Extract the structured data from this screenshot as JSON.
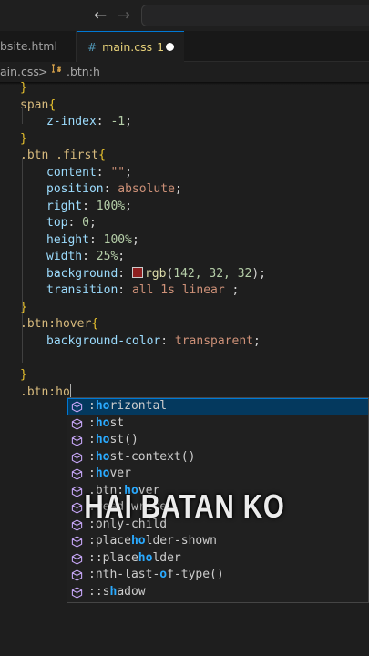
{
  "titlebar": {
    "back_icon": "←",
    "forward_icon": "→"
  },
  "tabs": [
    {
      "label": "bsite.html"
    },
    {
      "label": "main.css",
      "icon": "#",
      "problems": "1",
      "modified": true
    }
  ],
  "breadcrumbs": {
    "file": "ain.css",
    "separator": ">",
    "symbol": ".btn:h"
  },
  "code": {
    "l1": "}",
    "l2_sel": "span",
    "l2_brace": "{",
    "l3_prop": "z-index",
    "l3_colon": ": ",
    "l3_val": "-1",
    "l3_end": ";",
    "l4": "}",
    "l5_sel": ".btn .first",
    "l5_brace": "{",
    "l6_prop": "content",
    "l6_colon": ": ",
    "l6_val": "\"\"",
    "l6_end": ";",
    "l7_prop": "position",
    "l7_colon": ": ",
    "l7_val": "absolute",
    "l7_end": ";",
    "l8_prop": "right",
    "l8_colon": ": ",
    "l8_val": "100%",
    "l8_end": ";",
    "l9_prop": "top",
    "l9_colon": ": ",
    "l9_val": "0",
    "l9_end": ";",
    "l10_prop": "height",
    "l10_colon": ": ",
    "l10_val": "100%",
    "l10_end": ";",
    "l11_prop": "width",
    "l11_colon": ": ",
    "l11_val": "25%",
    "l11_end": ";",
    "l12_prop": "background",
    "l12_colon": ": ",
    "l12_fn": "rgb",
    "l12_open": "(",
    "l12_args": "142, 32, 32",
    "l12_close": ")",
    "l12_end": ";",
    "l13_prop": "transition",
    "l13_colon": ": ",
    "l13_val": "all 1s linear",
    "l13_end": " ;",
    "l14": "}",
    "l15_sel": ".btn:hover",
    "l15_brace": "{",
    "l16_prop": "background-color",
    "l16_colon": ": ",
    "l16_val": "transparent",
    "l16_end": ";",
    "l18": "}",
    "l19_sel": ".btn:ho"
  },
  "swatch_color": "#8e2020",
  "suggestions": [
    {
      "pre": ":",
      "hl": "ho",
      "post": "rizontal",
      "selected": true
    },
    {
      "pre": ":",
      "hl": "ho",
      "post": "st"
    },
    {
      "pre": ":",
      "hl": "ho",
      "post": "st()"
    },
    {
      "pre": ":",
      "hl": "ho",
      "post": "st-context()"
    },
    {
      "pre": ":",
      "hl": "ho",
      "post": "ver"
    },
    {
      "pre": ".btn:",
      "hl": "ho",
      "post": "ver"
    },
    {
      "pre": ":",
      "hl": "",
      "post": "read-write"
    },
    {
      "pre": ":",
      "hl": "",
      "post": "only-child"
    },
    {
      "pre": ":place",
      "hl": "ho",
      "post": "lder-shown"
    },
    {
      "pre": "::place",
      "hl": "ho",
      "post": "lder"
    },
    {
      "pre": ":nth-last-",
      "hl": "o",
      "post": "f-type()"
    },
    {
      "pre": "::s",
      "hl": "h",
      "post": "adow"
    }
  ],
  "watermark": "HAI BATAN KO"
}
